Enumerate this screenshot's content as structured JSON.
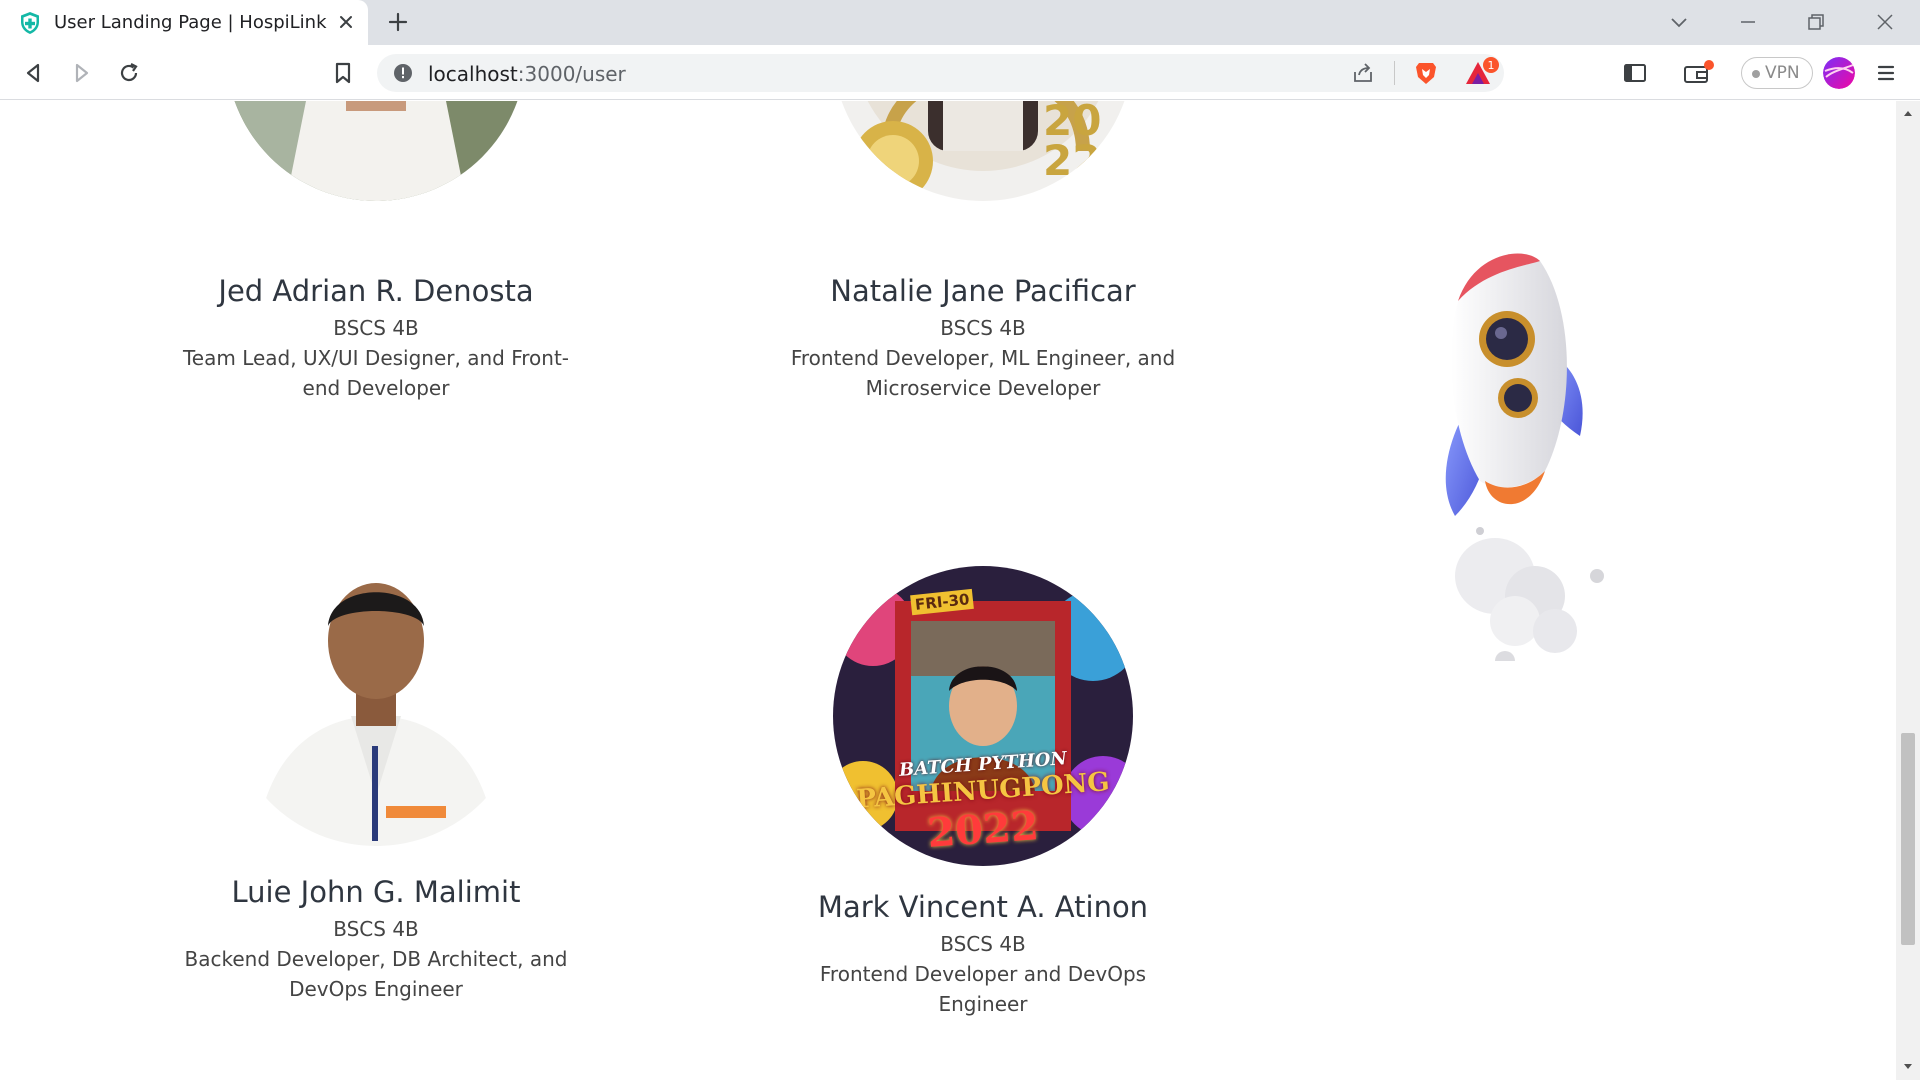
{
  "browser": {
    "tab_title": "User Landing Page | HospiLink",
    "url_host": "localhost",
    "url_path": ":3000/user",
    "vpn_label": "VPN",
    "notification_count": "1"
  },
  "members": [
    {
      "name": "Jed Adrian R. Denosta",
      "class": "BSCS 4B",
      "role": "Team Lead, UX/UI Designer, and Front-end Developer"
    },
    {
      "name": "Natalie Jane Pacificar",
      "class": "BSCS 4B",
      "role": "Frontend Developer, ML Engineer, and Microservice Developer"
    },
    {
      "name": "Luie John G. Malimit",
      "class": "BSCS 4B",
      "role": "Backend Developer, DB Architect, and DevOps Engineer"
    },
    {
      "name": "Mark Vincent A. Atinon",
      "class": "BSCS 4B",
      "role": "Frontend Developer and DevOps Engineer"
    }
  ],
  "photo_badges": {
    "year_digits": [
      "20",
      "22"
    ],
    "fri": "FRI-30",
    "batch": "BATCH PYTHON",
    "event": "PAGHINUGPONG",
    "year": "2022"
  },
  "colors": {
    "accent": "#0d9488",
    "brave_orange": "#fb542b",
    "text_dark": "#2f3640"
  }
}
